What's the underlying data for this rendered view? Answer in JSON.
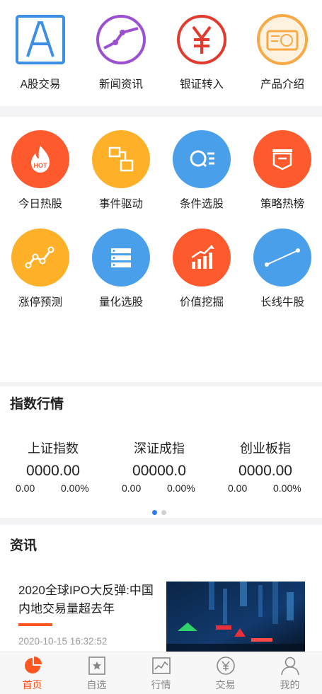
{
  "top_nav": [
    {
      "label": "A股交易",
      "icon": "a-letter-icon"
    },
    {
      "label": "新闻资讯",
      "icon": "trend-line-icon"
    },
    {
      "label": "银证转入",
      "icon": "yen-circle-icon"
    },
    {
      "label": "产品介绍",
      "icon": "ticket-icon"
    }
  ],
  "features": [
    {
      "label": "今日热股",
      "icon": "fire-hot-icon",
      "color": "#ff5a2e"
    },
    {
      "label": "事件驱动",
      "icon": "flow-icon",
      "color": "#fdb028"
    },
    {
      "label": "条件选股",
      "icon": "search-list-icon",
      "color": "#4a9fea"
    },
    {
      "label": "策略热榜",
      "icon": "banner-icon",
      "color": "#ff5a2e"
    },
    {
      "label": "涨停预测",
      "icon": "zigzag-icon",
      "color": "#fdb028"
    },
    {
      "label": "量化选股",
      "icon": "server-icon",
      "color": "#4a9fea"
    },
    {
      "label": "价值挖掘",
      "icon": "bar-growth-icon",
      "color": "#ff5a2e"
    },
    {
      "label": "长线牛股",
      "icon": "long-line-icon",
      "color": "#4a9fea"
    }
  ],
  "index_section": {
    "title": "指数行情",
    "indices": [
      {
        "name": "上证指数",
        "value": "0000.00",
        "change": "0.00",
        "percent": "0.00%"
      },
      {
        "name": "深证成指",
        "value": "00000.0",
        "change": "0.00",
        "percent": "0.00%"
      },
      {
        "name": "创业板指",
        "value": "0000.00",
        "change": "0.00",
        "percent": "0.00%"
      }
    ]
  },
  "news_section": {
    "title": "资讯",
    "item": {
      "title": "2020全球IPO大反弹:中国内地交易量超去年",
      "time": "2020-10-15 16:32:52"
    }
  },
  "tabbar": [
    {
      "label": "首页",
      "icon": "home-pie-icon",
      "active": true
    },
    {
      "label": "自选",
      "icon": "star-bookmark-icon",
      "active": false
    },
    {
      "label": "行情",
      "icon": "chart-icon",
      "active": false
    },
    {
      "label": "交易",
      "icon": "yen-icon",
      "active": false
    },
    {
      "label": "我的",
      "icon": "user-icon",
      "active": false
    }
  ],
  "colors": {
    "accent": "#ff5520",
    "blue": "#4a9fea",
    "orange": "#fdb028",
    "red": "#ff5a2e"
  }
}
